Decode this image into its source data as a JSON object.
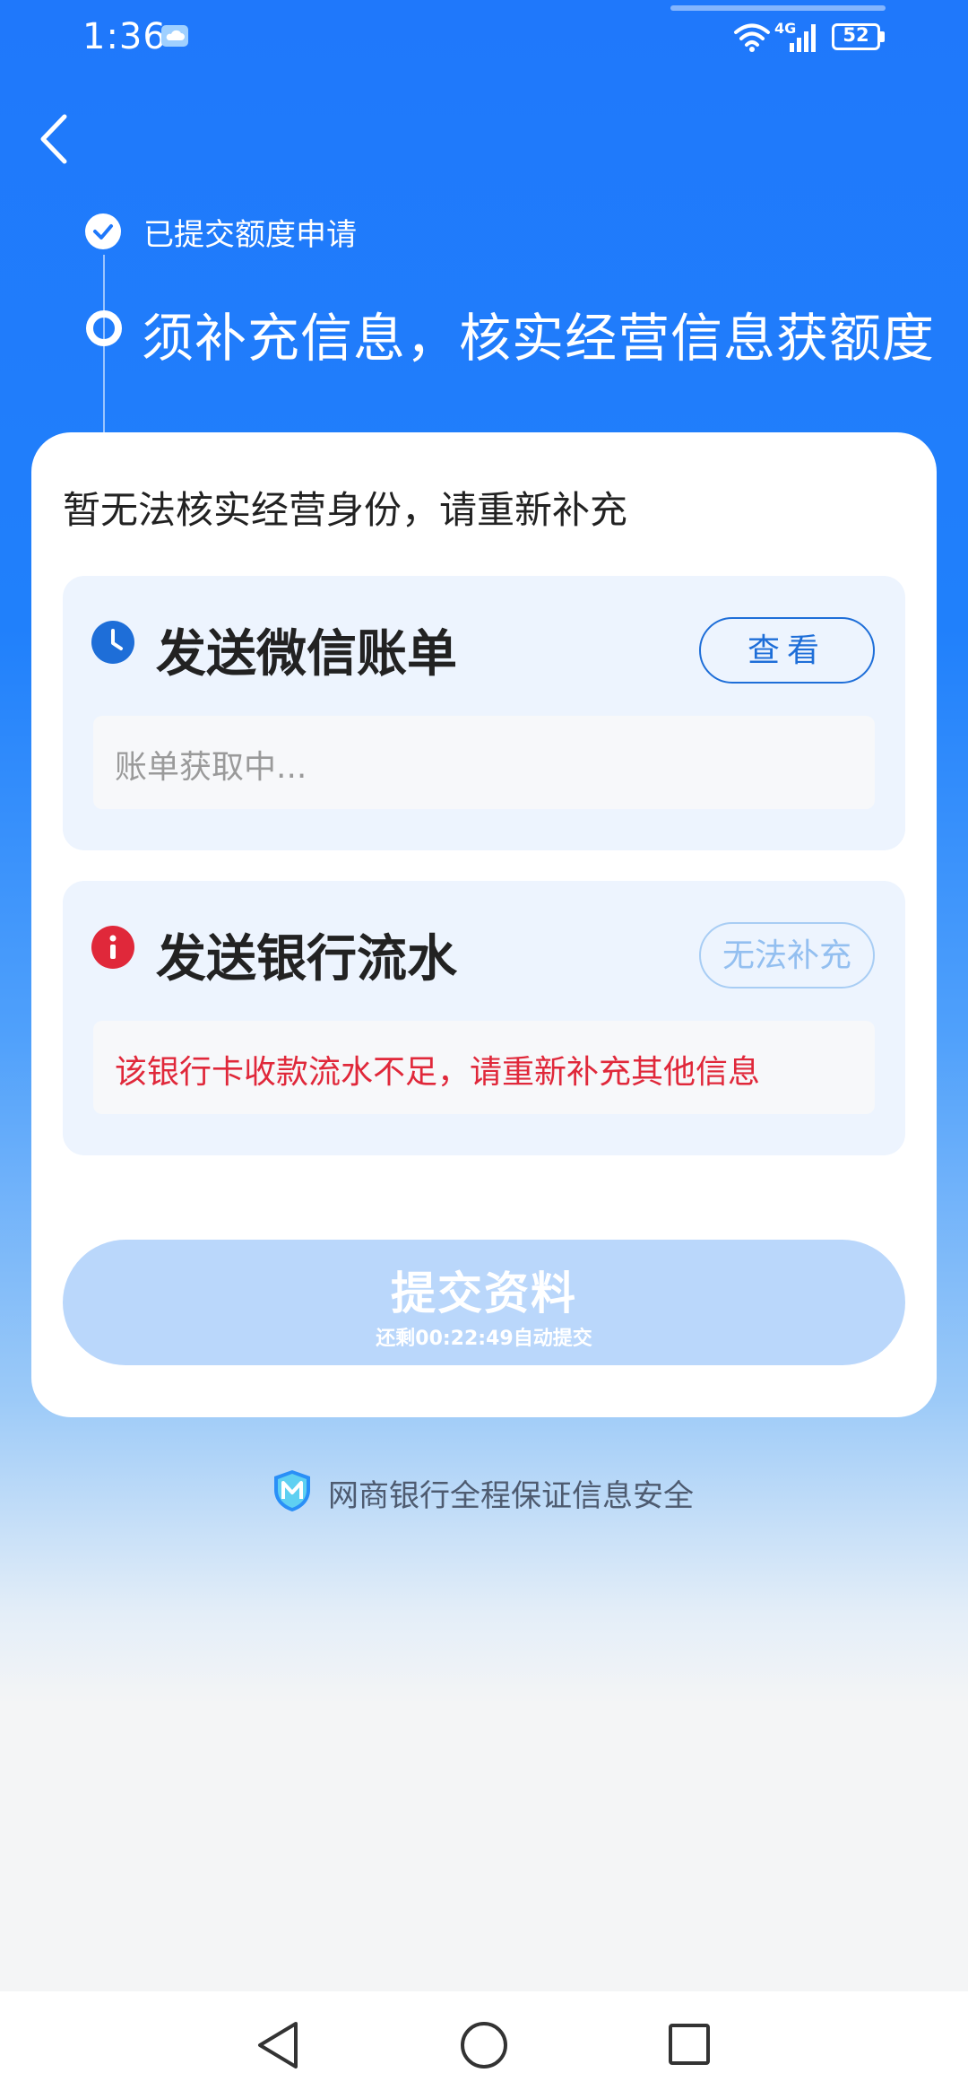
{
  "status_bar": {
    "time": "1:36",
    "network": "4G",
    "battery": "52",
    "icons": [
      "cloud-icon",
      "wifi-icon",
      "signal-icon",
      "battery-icon"
    ]
  },
  "header": {
    "back_icon": "chevron-left-icon",
    "steps": [
      {
        "label": "已提交额度申请",
        "state": "done",
        "icon": "check-circle-icon"
      },
      {
        "label": "须补充信息，核实经营信息获额度",
        "state": "current",
        "icon": "ring-icon"
      }
    ]
  },
  "card": {
    "notice": "暂无法核实经营身份，请重新补充",
    "tasks": [
      {
        "title": "发送微信账单",
        "icon": "clock-icon",
        "icon_color": "#1e6ed8",
        "button_label": "查看",
        "status_text": "账单获取中..."
      },
      {
        "title": "发送银行流水",
        "icon": "alert-icon",
        "icon_color": "#e0283a",
        "button_label": "无法补充",
        "status_text": "该银行卡收款流水不足，请重新补充其他信息"
      }
    ],
    "submit": {
      "label": "提交资料",
      "countdown": "还剩00:22:49自动提交"
    }
  },
  "footer": {
    "security_text": "网商银行全程保证信息安全",
    "icon": "shield-icon"
  },
  "nav_bar": {
    "icons": [
      "back-triangle-icon",
      "home-circle-icon",
      "recents-square-icon"
    ]
  },
  "colors": {
    "primary": "#1f78fb",
    "text_dark": "#222222",
    "error": "#e0283a",
    "submit_disabled": "#bad7fb"
  }
}
